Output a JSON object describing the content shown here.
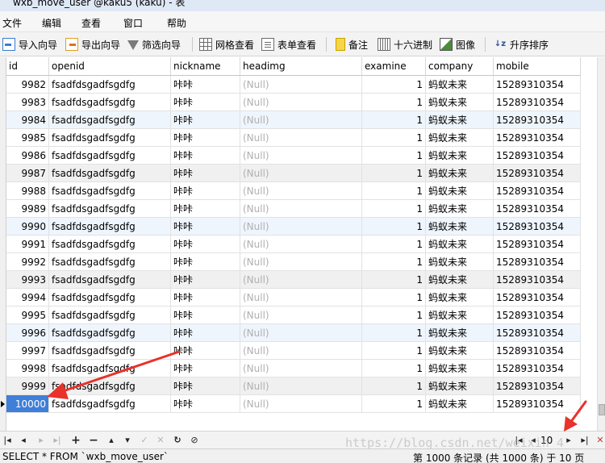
{
  "window": {
    "title": "wxb_move_user @kaku5 (kaku) - 表"
  },
  "menu": [
    "文件",
    "编辑",
    "查看",
    "窗口",
    "帮助"
  ],
  "toolbar": {
    "import": "导入向导",
    "export": "导出向导",
    "filter": "筛选向导",
    "grid_view": "网格查看",
    "form_view": "表单查看",
    "memo": "备注",
    "hex": "十六进制",
    "image": "图像",
    "sort": "升序排序"
  },
  "table": {
    "columns": [
      "id",
      "openid",
      "nickname",
      "headimg",
      "examine",
      "company",
      "mobile"
    ],
    "rows": [
      [
        "9982",
        "fsadfdsgadfsgdfg",
        "咔咔",
        "(Null)",
        "1",
        "蚂蚁未来",
        "15289310354"
      ],
      [
        "9983",
        "fsadfdsgadfsgdfg",
        "咔咔",
        "(Null)",
        "1",
        "蚂蚁未来",
        "15289310354"
      ],
      [
        "9984",
        "fsadfdsgadfsgdfg",
        "咔咔",
        "(Null)",
        "1",
        "蚂蚁未来",
        "15289310354"
      ],
      [
        "9985",
        "fsadfdsgadfsgdfg",
        "咔咔",
        "(Null)",
        "1",
        "蚂蚁未来",
        "15289310354"
      ],
      [
        "9986",
        "fsadfdsgadfsgdfg",
        "咔咔",
        "(Null)",
        "1",
        "蚂蚁未来",
        "15289310354"
      ],
      [
        "9987",
        "fsadfdsgadfsgdfg",
        "咔咔",
        "(Null)",
        "1",
        "蚂蚁未来",
        "15289310354"
      ],
      [
        "9988",
        "fsadfdsgadfsgdfg",
        "咔咔",
        "(Null)",
        "1",
        "蚂蚁未来",
        "15289310354"
      ],
      [
        "9989",
        "fsadfdsgadfsgdfg",
        "咔咔",
        "(Null)",
        "1",
        "蚂蚁未来",
        "15289310354"
      ],
      [
        "9990",
        "fsadfdsgadfsgdfg",
        "咔咔",
        "(Null)",
        "1",
        "蚂蚁未来",
        "15289310354"
      ],
      [
        "9991",
        "fsadfdsgadfsgdfg",
        "咔咔",
        "(Null)",
        "1",
        "蚂蚁未来",
        "15289310354"
      ],
      [
        "9992",
        "fsadfdsgadfsgdfg",
        "咔咔",
        "(Null)",
        "1",
        "蚂蚁未来",
        "15289310354"
      ],
      [
        "9993",
        "fsadfdsgadfsgdfg",
        "咔咔",
        "(Null)",
        "1",
        "蚂蚁未来",
        "15289310354"
      ],
      [
        "9994",
        "fsadfdsgadfsgdfg",
        "咔咔",
        "(Null)",
        "1",
        "蚂蚁未来",
        "15289310354"
      ],
      [
        "9995",
        "fsadfdsgadfsgdfg",
        "咔咔",
        "(Null)",
        "1",
        "蚂蚁未来",
        "15289310354"
      ],
      [
        "9996",
        "fsadfdsgadfsgdfg",
        "咔咔",
        "(Null)",
        "1",
        "蚂蚁未来",
        "15289310354"
      ],
      [
        "9997",
        "fsadfdsgadfsgdfg",
        "咔咔",
        "(Null)",
        "1",
        "蚂蚁未来",
        "15289310354"
      ],
      [
        "9998",
        "fsadfdsgadfsgdfg",
        "咔咔",
        "(Null)",
        "1",
        "蚂蚁未来",
        "15289310354"
      ],
      [
        "9999",
        "fsadfdsgadfsgdfg",
        "咔咔",
        "(Null)",
        "1",
        "蚂蚁未来",
        "15289310354"
      ],
      [
        "10000",
        "fsadfdsgadfsgdfg",
        "咔咔",
        "(Null)",
        "1",
        "蚂蚁未来",
        "15289310354"
      ]
    ],
    "selected_row": 18
  },
  "pagination": {
    "current_page": "10"
  },
  "watermark": "https://blog.csdn.net/weixin_4",
  "status": {
    "sql": "SELECT * FROM `wxb_move_user`",
    "records": "第 1000 条记录 (共 1000 条) 于 10 页"
  },
  "colors": {
    "selection": "#3f7fd8",
    "row_alt": "#eef5fd",
    "annotation_arrow": "#e8322a",
    "null_text": "#b0b0b0"
  },
  "icons": [
    "import-icon",
    "export-icon",
    "filter-icon",
    "grid-icon",
    "form-icon",
    "memo-icon",
    "hex-icon",
    "image-icon",
    "sort-az-icon",
    "first-icon",
    "prev-icon",
    "next-icon",
    "last-icon",
    "add-icon",
    "delete-icon",
    "up-icon",
    "down-icon",
    "check-icon",
    "cancel-icon",
    "refresh-icon",
    "stop-icon",
    "page-first-icon",
    "page-prev-icon",
    "page-next-icon",
    "page-last-icon",
    "close-icon"
  ]
}
